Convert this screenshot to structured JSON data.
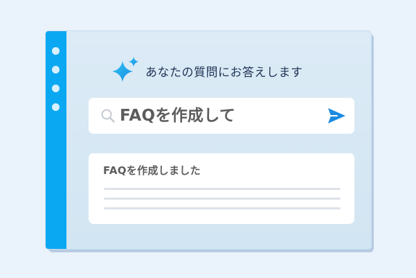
{
  "header": {
    "title": "あなたの質問にお答えします",
    "icon": "sparkle-icon"
  },
  "search": {
    "value": "FAQを作成して",
    "search_icon": "search-icon",
    "send_icon": "send-icon"
  },
  "answer": {
    "title": "FAQを作成しました"
  },
  "colors": {
    "background": "#eaf2fc",
    "window": "#dcebf6",
    "sidebar": "#0aa8f2",
    "accent": "#1d8ae0",
    "text": "#5d5d5d",
    "title_text": "#1f3354"
  }
}
